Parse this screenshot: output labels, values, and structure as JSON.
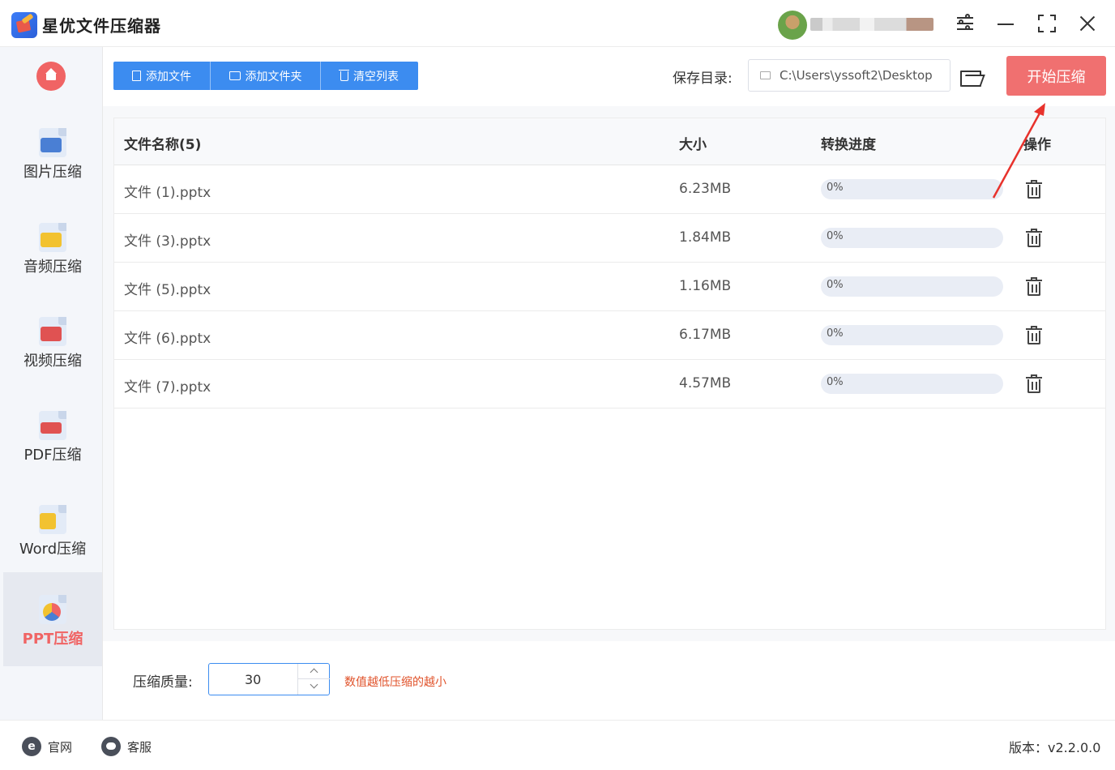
{
  "app": {
    "title": "星优文件压缩器"
  },
  "sidebar": {
    "items": [
      {
        "label": "图片压缩",
        "icon": "image-icon",
        "color": "#4a7fd4"
      },
      {
        "label": "音频压缩",
        "icon": "music-icon",
        "color": "#f2c230"
      },
      {
        "label": "视频压缩",
        "icon": "video-icon",
        "color": "#e05252"
      },
      {
        "label": "PDF压缩",
        "icon": "pdf-icon",
        "color": "#e05252"
      },
      {
        "label": "Word压缩",
        "icon": "word-icon",
        "color": "#f2c230"
      },
      {
        "label": "PPT压缩",
        "icon": "ppt-icon",
        "color": "#f06464",
        "active": true
      }
    ]
  },
  "toolbar": {
    "add_file": "添加文件",
    "add_folder": "添加文件夹",
    "clear_list": "清空列表",
    "save_dir_label": "保存目录:",
    "save_dir_path": "C:\\Users\\yssoft2\\Desktop",
    "start_button": "开始压缩"
  },
  "table": {
    "headers": {
      "name": "文件名称(5)",
      "size": "大小",
      "progress": "转换进度",
      "action": "操作"
    },
    "rows": [
      {
        "name": "文件 (1).pptx",
        "size": "6.23MB",
        "progress": "0%"
      },
      {
        "name": "文件 (3).pptx",
        "size": "1.84MB",
        "progress": "0%"
      },
      {
        "name": "文件 (5).pptx",
        "size": "1.16MB",
        "progress": "0%"
      },
      {
        "name": "文件 (6).pptx",
        "size": "6.17MB",
        "progress": "0%"
      },
      {
        "name": "文件 (7).pptx",
        "size": "4.57MB",
        "progress": "0%"
      }
    ]
  },
  "quality": {
    "label": "压缩质量:",
    "value": "30",
    "hint": "数值越低压缩的越小"
  },
  "footer": {
    "website": "官网",
    "support": "客服",
    "version": "版本：v2.2.0.0"
  },
  "colors": {
    "accent_blue": "#3c8cf0",
    "start_red": "#f07070",
    "hint_orange": "#e0522a"
  }
}
